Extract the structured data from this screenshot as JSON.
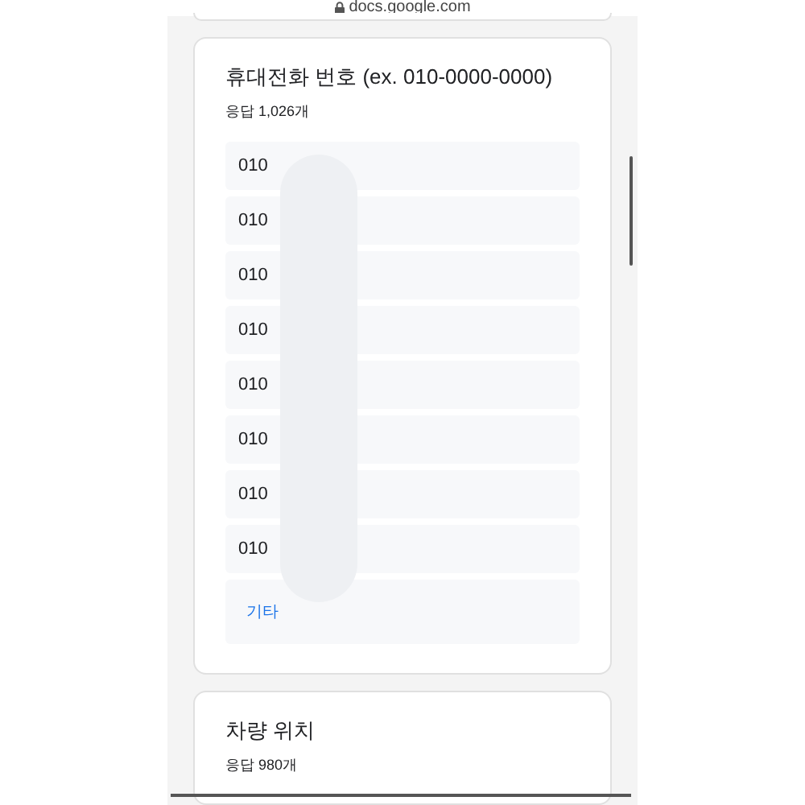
{
  "address_bar": {
    "url": "docs.google.com"
  },
  "questions": [
    {
      "title": "휴대전화 번호 (ex. 010-0000-0000)",
      "count": "응답 1,026개",
      "answers": [
        {
          "kind": "answer",
          "text": "010"
        },
        {
          "kind": "answer",
          "text": "010"
        },
        {
          "kind": "answer",
          "text": "010"
        },
        {
          "kind": "answer",
          "text": "010"
        },
        {
          "kind": "answer",
          "text": "010"
        },
        {
          "kind": "answer",
          "text": "010"
        },
        {
          "kind": "answer",
          "text": "010"
        },
        {
          "kind": "answer",
          "text": "010"
        },
        {
          "kind": "more",
          "text": "기타"
        }
      ]
    },
    {
      "title": "차량 위치",
      "count": "응답 980개"
    }
  ]
}
